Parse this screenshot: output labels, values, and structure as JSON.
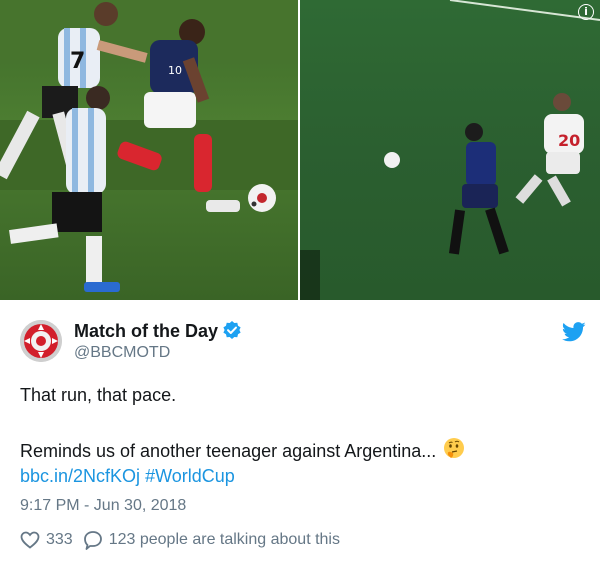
{
  "media": {
    "left_photo": "Mbappe dribbling past Argentina defenders",
    "right_photo": "Owen running with ball against Argentina"
  },
  "tweet": {
    "display_name": "Match of the Day",
    "handle": "@BBCMOTD",
    "text_line1": "That run, that pace.",
    "text_line2": "Reminds us of another teenager against Argentina...",
    "link": "bbc.in/2NcfKOj",
    "hashtag": "#WorldCup",
    "timestamp": "9:17 PM - Jun 30, 2018",
    "like_count": "333",
    "reply_text": "123 people are talking about this"
  },
  "colors": {
    "link": "#1b95e0",
    "secondary_text": "#657786",
    "twitter_blue": "#1da1f2"
  },
  "icons": [
    "info-icon",
    "verified-badge-icon",
    "twitter-bird-icon",
    "thinking-face-icon",
    "heart-icon",
    "reply-bubble-icon"
  ]
}
